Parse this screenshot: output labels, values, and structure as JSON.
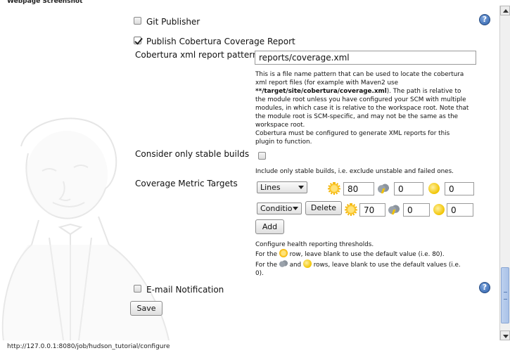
{
  "caption": "Webpage Screenshot",
  "git_publisher": {
    "label": "Git Publisher",
    "checked": false
  },
  "cobertura": {
    "label": "Publish Cobertura Coverage Report",
    "checked": true,
    "pattern_label": "Cobertura xml report pattern",
    "pattern_value": "reports/coverage.xml",
    "help_lines": [
      "This is a file name pattern that can be used to locate the cobertura",
      "xml report files (for example with Maven2 use",
      "**/target/site/cobertura/coverage.xml",
      "). The path is relative to",
      "the module root unless you have configured your SCM with multiple",
      "modules, in which case it is relative to the workspace root. Note that",
      "the module root is SCM-specific, and may not be the same as the",
      "workspace root.",
      "Cobertura must be configured to generate XML reports for this",
      "plugin to function."
    ],
    "stable_label": "Consider only stable builds",
    "stable_checked": false,
    "stable_help": "Include only stable builds, i.e. exclude unstable and failed ones.",
    "metric_label": "Coverage Metric Targets",
    "metrics": [
      {
        "type": "Lines",
        "healthy": "80",
        "unhealthy": "0",
        "failing": "0"
      },
      {
        "type": "Conditio",
        "healthy": "70",
        "unhealthy": "0",
        "failing": "0"
      }
    ],
    "delete_label": "Delete",
    "add_label": "Add",
    "thresholds_help_1": "Configure health reporting thresholds.",
    "thresholds_help_2a": "For the",
    "thresholds_help_2b": "row, leave blank to use the default value (i.e. 80).",
    "thresholds_help_3a": "For the",
    "thresholds_help_3b": "and",
    "thresholds_help_3c": "rows, leave blank to use the default values (i.e.",
    "thresholds_help_3d": "0)."
  },
  "email": {
    "label": "E-mail Notification",
    "checked": false
  },
  "save_label": "Save",
  "icons": {
    "help": "help-icon",
    "healthy": "sun-icon",
    "unhealthy": "storm-cloud-icon",
    "failing": "moon-icon"
  },
  "status_url": "http://127.0.0.1:8080/job/hudson_tutorial/configure"
}
